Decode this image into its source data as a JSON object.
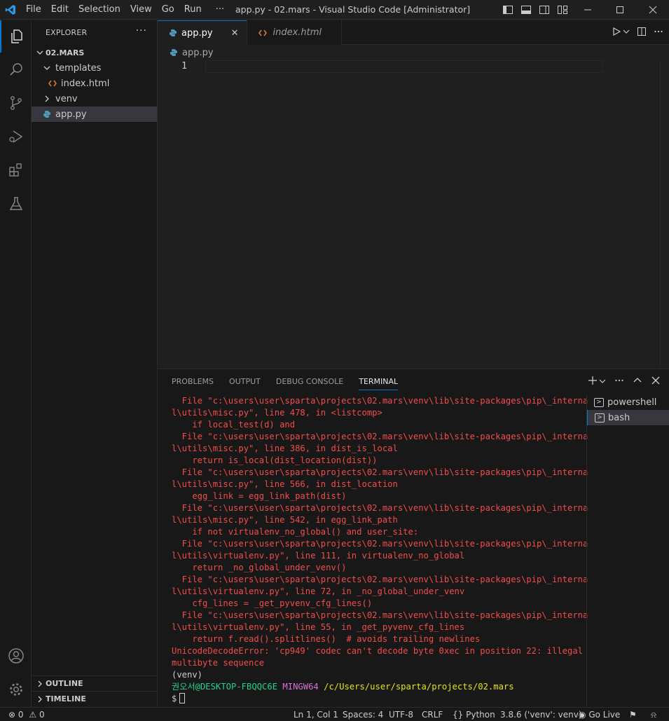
{
  "window": {
    "title": "app.py - 02.mars - Visual Studio Code [Administrator]",
    "menu": [
      "File",
      "Edit",
      "Selection",
      "View",
      "Go",
      "Run",
      "···"
    ]
  },
  "sidebar": {
    "header": "EXPLORER",
    "more": "···",
    "project": "02.MARS",
    "tree": {
      "templates": "templates",
      "index_html": "index.html",
      "venv": "venv",
      "app_py": "app.py"
    },
    "outline": "OUTLINE",
    "timeline": "TIMELINE"
  },
  "editor": {
    "tabs": [
      {
        "label": "app.py",
        "close": "✕"
      },
      {
        "label": "index.html"
      }
    ],
    "breadcrumb": "app.py",
    "line_number": "1"
  },
  "panel": {
    "tabs": [
      "PROBLEMS",
      "OUTPUT",
      "DEBUG CONSOLE",
      "TERMINAL"
    ],
    "terminal_lines": [
      "  File \"c:\\users\\user\\sparta\\projects\\02.mars\\venv\\lib\\site-packages\\pip\\_interna",
      "l\\utils\\misc.py\", line 478, in <listcomp>",
      "    if local_test(d) and",
      "  File \"c:\\users\\user\\sparta\\projects\\02.mars\\venv\\lib\\site-packages\\pip\\_interna",
      "l\\utils\\misc.py\", line 386, in dist_is_local",
      "    return is_local(dist_location(dist))",
      "  File \"c:\\users\\user\\sparta\\projects\\02.mars\\venv\\lib\\site-packages\\pip\\_interna",
      "l\\utils\\misc.py\", line 566, in dist_location",
      "    egg_link = egg_link_path(dist)",
      "  File \"c:\\users\\user\\sparta\\projects\\02.mars\\venv\\lib\\site-packages\\pip\\_interna",
      "l\\utils\\misc.py\", line 542, in egg_link_path",
      "    if not virtualenv_no_global() and user_site:",
      "  File \"c:\\users\\user\\sparta\\projects\\02.mars\\venv\\lib\\site-packages\\pip\\_interna",
      "l\\utils\\virtualenv.py\", line 111, in virtualenv_no_global",
      "    return _no_global_under_venv()",
      "  File \"c:\\users\\user\\sparta\\projects\\02.mars\\venv\\lib\\site-packages\\pip\\_interna",
      "l\\utils\\virtualenv.py\", line 72, in _no_global_under_venv",
      "    cfg_lines = _get_pyvenv_cfg_lines()",
      "  File \"c:\\users\\user\\sparta\\projects\\02.mars\\venv\\lib\\site-packages\\pip\\_interna",
      "l\\utils\\virtualenv.py\", line 55, in _get_pyvenv_cfg_lines",
      "    return f.read().splitlines()  # avoids trailing newlines",
      "UnicodeDecodeError: 'cp949' codec can't decode byte 0xec in position 22: illegal",
      "multibyte sequence"
    ],
    "venv_line": "(venv)",
    "prompt": {
      "user_host": "권오서@DESKTOP-FBQQC6E",
      "shell": "MINGW64",
      "path": "/c/Users/user/sparta/projects/02.mars",
      "symbol": "$"
    },
    "terminals": [
      "powershell",
      "bash"
    ]
  },
  "statusbar": {
    "errors": "0",
    "warnings": "0",
    "position": "Ln 1, Col 1",
    "spaces": "Spaces: 4",
    "encoding": "UTF-8",
    "eol": "CRLF",
    "language": "Python",
    "interpreter": "3.8.6 ('venv': venv)",
    "golive": "Go Live"
  },
  "colors": {
    "accent": "#0078d4",
    "error_text": "#f14c4c",
    "prompt_user": "#23d18b",
    "prompt_shell": "#d670d6",
    "prompt_path": "#e5e510",
    "python_icon": "#519aba",
    "html_icon": "#e37933"
  }
}
